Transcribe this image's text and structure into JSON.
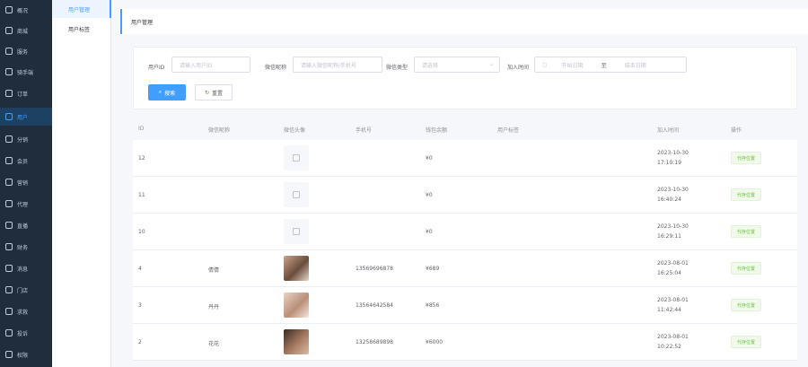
{
  "sidebar": {
    "items": [
      {
        "label": "概况",
        "icon": "home-icon"
      },
      {
        "label": "商城",
        "icon": "shop-icon"
      },
      {
        "label": "服务",
        "icon": "service-icon"
      },
      {
        "label": "骑手端",
        "icon": "rider-icon"
      },
      {
        "label": "订单",
        "icon": "order-icon"
      },
      {
        "label": "用户",
        "icon": "user-icon",
        "active": true
      },
      {
        "label": "分销",
        "icon": "distribution-icon"
      },
      {
        "label": "会员",
        "icon": "member-icon"
      },
      {
        "label": "营销",
        "icon": "marketing-icon"
      },
      {
        "label": "代理",
        "icon": "agent-icon"
      },
      {
        "label": "直播",
        "icon": "live-icon"
      },
      {
        "label": "财务",
        "icon": "finance-icon"
      },
      {
        "label": "消息",
        "icon": "message-icon"
      },
      {
        "label": "门店",
        "icon": "store-icon"
      },
      {
        "label": "求救",
        "icon": "sos-icon"
      },
      {
        "label": "投诉",
        "icon": "complaint-icon"
      },
      {
        "label": "权限",
        "icon": "permission-icon"
      }
    ]
  },
  "submenu": {
    "items": [
      {
        "label": "用户管理",
        "active": true
      },
      {
        "label": "用户标签"
      }
    ]
  },
  "header": {
    "title": "用户管理"
  },
  "filter": {
    "user_id_label": "用户ID",
    "user_id_placeholder": "请输入用户ID",
    "phone_label": "微信昵称",
    "phone_placeholder": "请输入微信昵称/手机号",
    "type_label": "微信类型",
    "type_placeholder": "请选择",
    "join_label": "加入时间",
    "join_start": "开始日期",
    "join_sep": "至",
    "join_end": "结束日期",
    "search_btn": "搜索",
    "reset_btn": "重置"
  },
  "table": {
    "headers": [
      "ID",
      "微信昵称",
      "微信头像",
      "手机号",
      "钱包余额",
      "用户标签",
      "加入时间",
      "操作"
    ],
    "rows": [
      {
        "id": "12",
        "nickname": "",
        "avatar": "placeholder",
        "phone": "",
        "balance": "¥0",
        "tags": "",
        "date": "2023-10-30",
        "time": "17:10:19",
        "action": "代存位置"
      },
      {
        "id": "11",
        "nickname": "",
        "avatar": "placeholder",
        "phone": "",
        "balance": "¥0",
        "tags": "",
        "date": "2023-10-30",
        "time": "16:40:24",
        "action": "代存位置"
      },
      {
        "id": "10",
        "nickname": "",
        "avatar": "placeholder",
        "phone": "",
        "balance": "¥0",
        "tags": "",
        "date": "2023-10-30",
        "time": "16:29:11",
        "action": "代存位置"
      },
      {
        "id": "4",
        "nickname": "倩倩",
        "avatar": "photo",
        "phone": "13569696878",
        "balance": "¥689",
        "tags": "",
        "date": "2023-08-01",
        "time": "16:25:04",
        "action": "代存位置"
      },
      {
        "id": "3",
        "nickname": "丹丹",
        "avatar": "photo",
        "phone": "13564642584",
        "balance": "¥856",
        "tags": "",
        "date": "2023-08-01",
        "time": "11:42:44",
        "action": "代存位置"
      },
      {
        "id": "2",
        "nickname": "花花",
        "avatar": "photo",
        "phone": "13258689898",
        "balance": "¥6000",
        "tags": "",
        "date": "2023-08-01",
        "time": "10:22:52",
        "action": "代存位置"
      }
    ]
  },
  "colors": {
    "accent": "#409eff",
    "sidebar_bg": "#1f2d3d",
    "tag_green": "#67c23a"
  }
}
